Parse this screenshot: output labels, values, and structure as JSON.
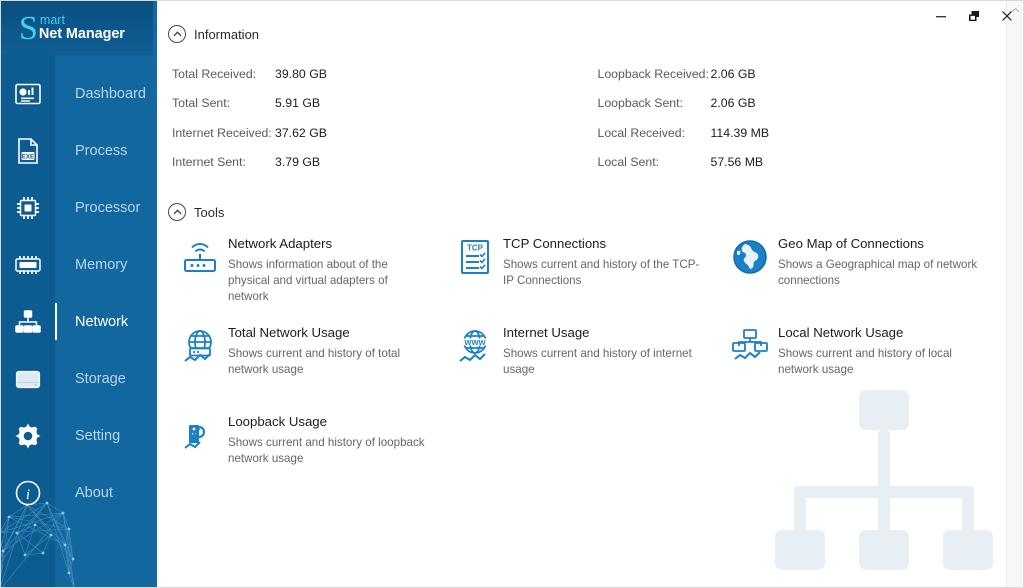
{
  "app": {
    "logo_initial": "S",
    "logo_part1": "mart",
    "logo_part2": "Net Manager",
    "accent_blue": "#1468a3",
    "sidebar_blue": "#12679f",
    "sidebar_icon_blue": "#0c5c92",
    "tool_icon_blue": "#1a81c7",
    "logo_cyan": "#3fd2f2"
  },
  "titlebar": {
    "minimize_label": "Minimize",
    "restore_label": "Restore",
    "close_label": "Close"
  },
  "sidebar": {
    "items": [
      {
        "label": "Dashboard",
        "icon": "dashboard-icon",
        "active": false
      },
      {
        "label": "Process",
        "icon": "process-exe-icon",
        "active": false
      },
      {
        "label": "Processor",
        "icon": "processor-chip-icon",
        "active": false
      },
      {
        "label": "Memory",
        "icon": "memory-ram-icon",
        "active": false
      },
      {
        "label": "Network",
        "icon": "network-tree-icon",
        "active": true
      },
      {
        "label": "Storage",
        "icon": "storage-drive-icon",
        "active": false
      },
      {
        "label": "Setting",
        "icon": "gear-icon",
        "active": false
      },
      {
        "label": "About",
        "icon": "info-circle-icon",
        "active": false
      }
    ]
  },
  "information": {
    "section_title": "Information",
    "left": [
      {
        "label": "Total Received:",
        "value": "39.80 GB"
      },
      {
        "label": "Total Sent:",
        "value": "5.91 GB"
      },
      {
        "label": "Internet Received:",
        "value": "37.62 GB"
      },
      {
        "label": "Internet Sent:",
        "value": "3.79 GB"
      }
    ],
    "right": [
      {
        "label": "Loopback Received:",
        "value": "2.06 GB"
      },
      {
        "label": "Loopback Sent:",
        "value": "2.06 GB"
      },
      {
        "label": "Local Received:",
        "value": "114.39 MB"
      },
      {
        "label": "Local Sent:",
        "value": "57.56 MB"
      }
    ]
  },
  "tools": {
    "section_title": "Tools",
    "items": [
      {
        "name": "Network Adapters",
        "desc": "Shows information about of the physical and virtual adapters of network",
        "icon": "router-wifi-icon"
      },
      {
        "name": "TCP Connections",
        "desc": "Shows current and history of the TCP-IP Connections",
        "icon": "tcp-checklist-icon"
      },
      {
        "name": "Geo Map of Connections",
        "desc": "Shows a Geographical map of network connections",
        "icon": "globe-icon"
      },
      {
        "name": "Total Network Usage",
        "desc": "Shows current and history of total network usage",
        "icon": "globe-graph-icon"
      },
      {
        "name": "Internet Usage",
        "desc": "Shows current and history of internet usage",
        "icon": "www-globe-icon"
      },
      {
        "name": "Local Network Usage",
        "desc": "Shows current and history of local network usage",
        "icon": "lan-monitors-icon"
      },
      {
        "name": "Loopback Usage",
        "desc": "Shows current and history of loopback network usage",
        "icon": "loopback-server-icon"
      }
    ]
  },
  "decor": {
    "watermark": "network-tree-watermark",
    "fingerprint": "mesh-head-graphic"
  }
}
